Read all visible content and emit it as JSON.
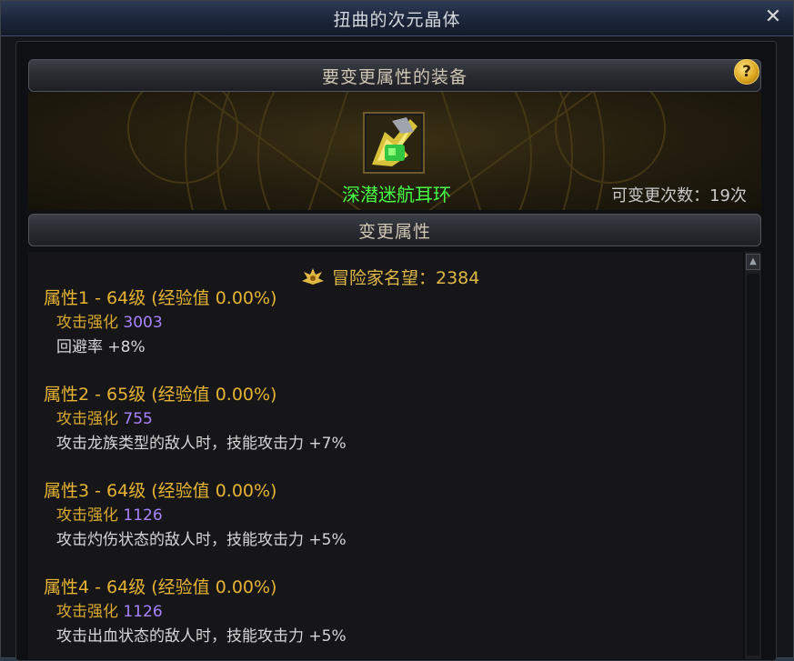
{
  "window": {
    "title": "扭曲的次元晶体",
    "close_label": "✕"
  },
  "equip_section": {
    "header": "要变更属性的装备",
    "help_label": "?",
    "item_name": "深潜迷航耳环",
    "change_count": "可变更次数：19次"
  },
  "change_section": {
    "header": "变更属性",
    "renown": "冒险家名望：2384"
  },
  "attributes": [
    {
      "title": "属性1 - 64级 (经验值 0.00%)",
      "stat_label": "攻击强化",
      "stat_value": "3003",
      "effect": "回避率 +8%"
    },
    {
      "title": "属性2 - 65级 (经验值 0.00%)",
      "stat_label": "攻击强化",
      "stat_value": "755",
      "effect": "攻击龙族类型的敌人时，技能攻击力 +7%"
    },
    {
      "title": "属性3 - 64级 (经验值 0.00%)",
      "stat_label": "攻击强化",
      "stat_value": "1126",
      "effect": "攻击灼伤状态的敌人时，技能攻击力 +5%"
    },
    {
      "title": "属性4 - 64级 (经验值 0.00%)",
      "stat_label": "攻击强化",
      "stat_value": "1126",
      "effect": "攻击出血状态的敌人时，技能攻击力 +5%"
    }
  ],
  "colors": {
    "item_name": "#45ff45",
    "attr_title": "#e6b432",
    "stat_value": "#a883ff",
    "renown": "#e0b846"
  },
  "icons": [
    "close-icon",
    "help-icon",
    "earring-item-icon",
    "renown-icon",
    "scroll-up-icon"
  ]
}
